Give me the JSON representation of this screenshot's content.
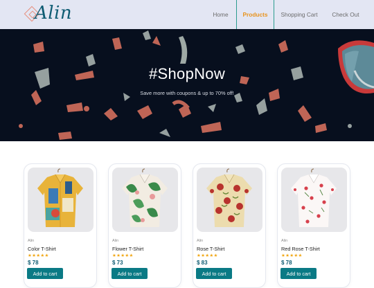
{
  "header": {
    "logo_text": "Alin",
    "nav": [
      {
        "label": "Home"
      },
      {
        "label": "Products"
      },
      {
        "label": "Shopping Cart"
      },
      {
        "label": "Check Out"
      }
    ]
  },
  "hero": {
    "title": "#ShopNow",
    "subtitle": "Save more with coupons & up to 70% off!"
  },
  "products": [
    {
      "brand": "Alin",
      "name": "Color T-Shirt",
      "stars": "★★★★★",
      "price": "$ 78",
      "button": "Add to cart"
    },
    {
      "brand": "Alin",
      "name": "Flower T-Shirt",
      "stars": "★★★★★",
      "price": "$ 73",
      "button": "Add to cart"
    },
    {
      "brand": "Alin",
      "name": "Rose T-Shirt",
      "stars": "★★★★★",
      "price": "$ 83",
      "button": "Add to cart"
    },
    {
      "brand": "Alin",
      "name": "Red Rose T-Shirt",
      "stars": "★★★★★",
      "price": "$ 78",
      "button": "Add to cart"
    }
  ],
  "colors": {
    "accent": "#0a7a85",
    "active_nav": "#e8931c",
    "hero_bg": "#070f1e",
    "header_bg": "#e3e6f3"
  }
}
